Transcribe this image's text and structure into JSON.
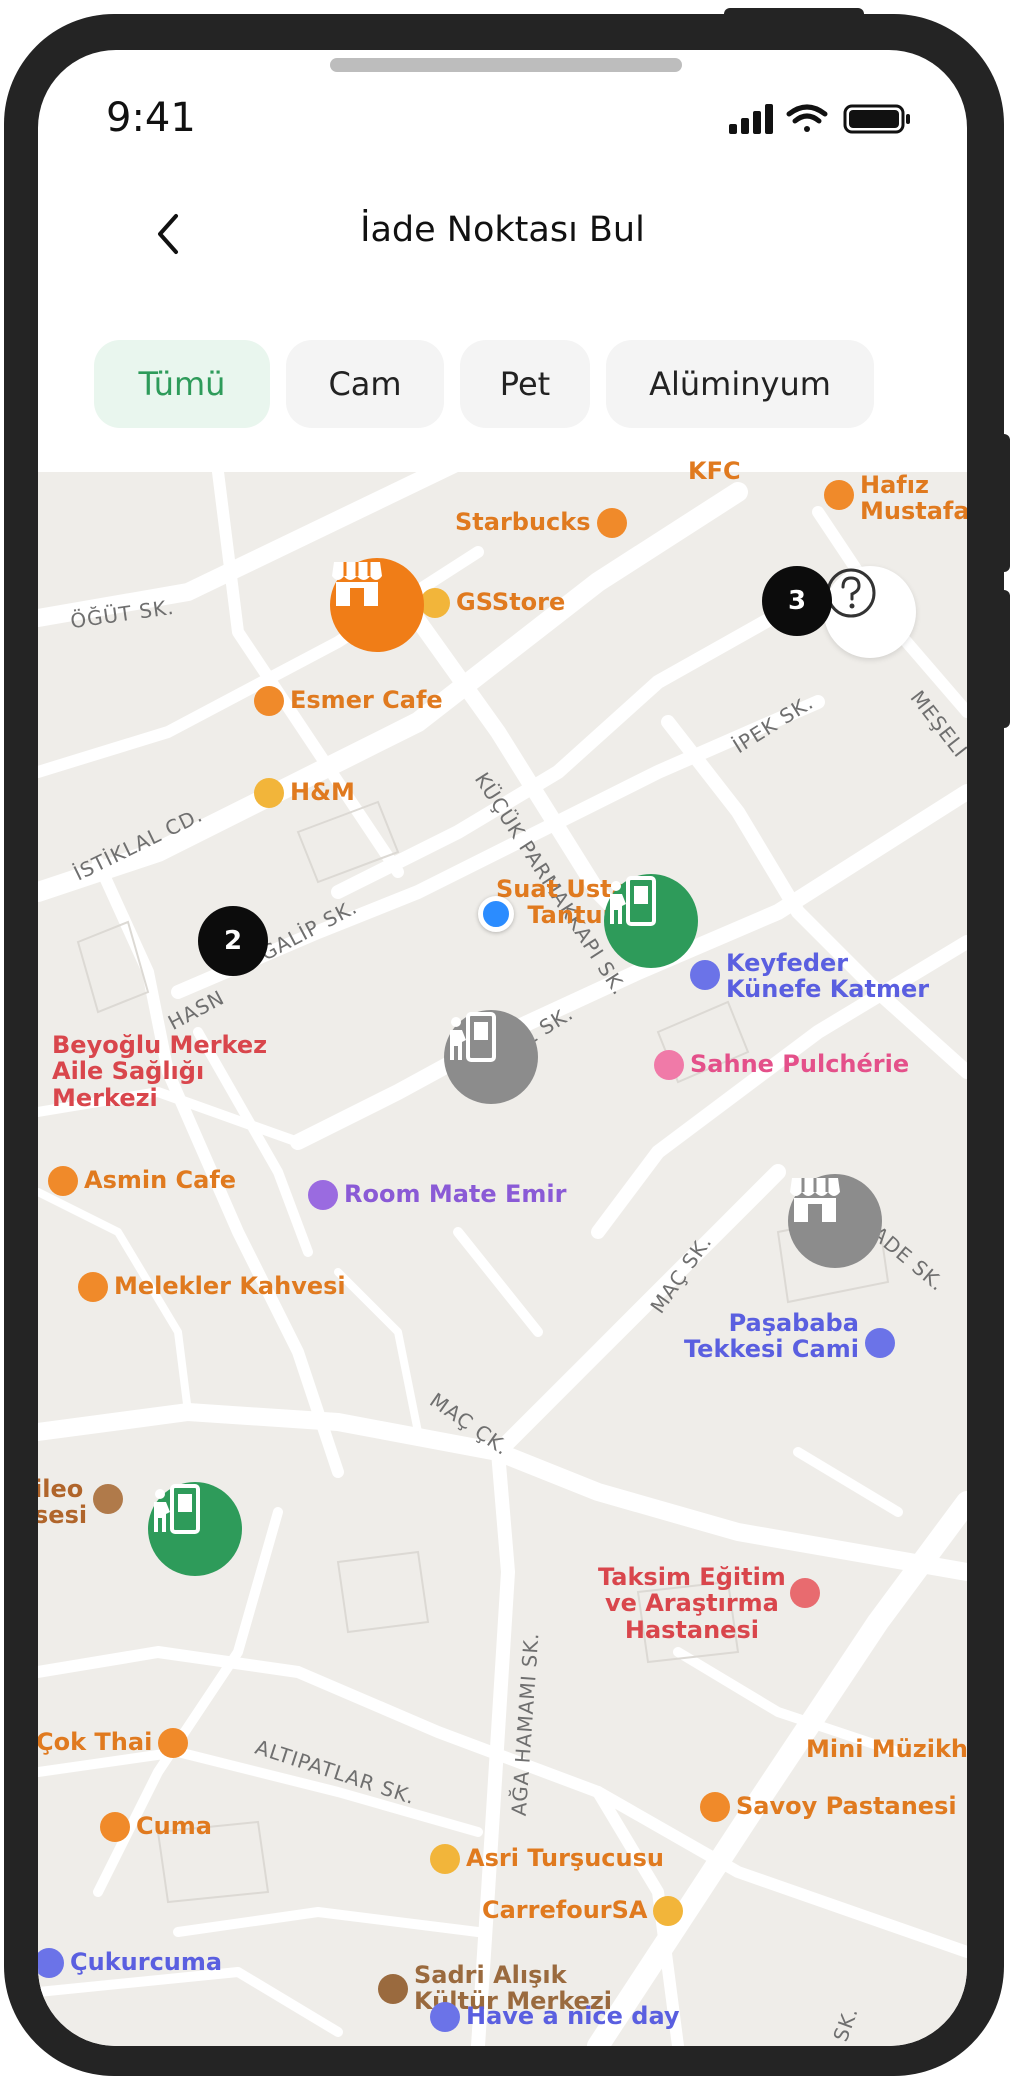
{
  "status": {
    "time": "9:41"
  },
  "header": {
    "title": "İade Noktası Bul",
    "back_icon": "chevron-left-icon"
  },
  "filters": [
    {
      "label": "Tümü",
      "active": true
    },
    {
      "label": "Cam",
      "active": false
    },
    {
      "label": "Pet",
      "active": false
    },
    {
      "label": "Alüminyum",
      "active": false
    }
  ],
  "colors": {
    "active_chip_bg": "#e9f6ee",
    "active_chip_text": "#2e9b5a",
    "marker_green": "#2e9b5a",
    "marker_orange": "#f07d17",
    "marker_gray": "#8c8c8c",
    "user_dot": "#2b8cff"
  },
  "map": {
    "badges": [
      "2",
      "3"
    ],
    "streets": [
      "ÖĞÜT SK.",
      "İSTİKLAL CD.",
      "KÜÇÜK PARMAKKAPI SK.",
      "İPEK SK.",
      "MEŞELİ",
      "HASN",
      "GALİP SK.",
      "EL SK.",
      "MAÇ SK.",
      "ZADE SK.",
      "MAÇ ÇK.",
      "AĞA HAMAMI SK.",
      "ALTIPATLAR SK.",
      "SK."
    ],
    "places": {
      "kfc": "KFC",
      "starbucks": "Starbucks",
      "hafiz": [
        "Hafız",
        "Mustafa"
      ],
      "gsstore": "GSStore",
      "esmer": "Esmer Cafe",
      "hm": "H&M",
      "suat": [
        "Suat Usta",
        "Tantuni"
      ],
      "keyfeder": [
        "Keyfeder",
        "Künefe Katmer"
      ],
      "beyoglu": [
        "Beyoğlu Merkez",
        "Aile Sağlığı",
        "Merkezi"
      ],
      "sahne": "Sahne Pulchérie",
      "asmin": "Asmin Cafe",
      "roommate": "Room Mate Emir",
      "melekler": "Melekler Kahvesi",
      "pasababa": [
        "Paşababa",
        "Tekkesi Cami"
      ],
      "ileo": [
        "ileo",
        "sesi"
      ],
      "taksim": [
        "Taksim Eğitim",
        "ve Araştırma",
        "Hastanesi"
      ],
      "cokthai": "Çok Thai",
      "mini": "Mini Müzikh",
      "savoy": "Savoy Pastanesi",
      "cuma": "Cuma",
      "asri": "Asri Turşucusu",
      "carrefour": "CarrefourSA",
      "cukurcuma": "Çukurcuma",
      "sadri": [
        "Sadri Alışık",
        "Kültür Merkezi"
      ],
      "nice": "Have a nice day"
    }
  }
}
